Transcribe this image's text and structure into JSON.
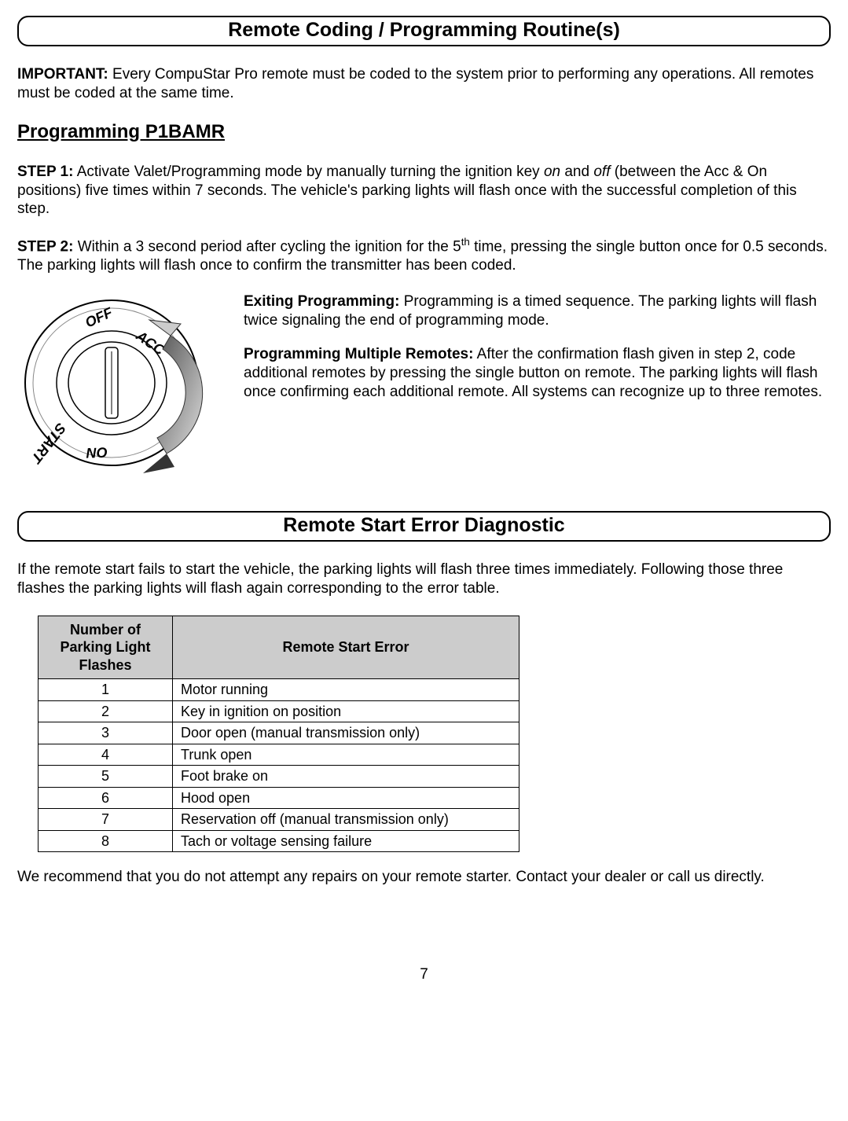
{
  "section1": {
    "title": "Remote Coding / Programming Routine(s)",
    "important_label": "IMPORTANT:",
    "important_text": " Every CompuStar Pro remote must be coded to the system prior to performing any operations. All remotes must be coded at the same time.",
    "subtitle": "Programming P1BAMR",
    "step1_label": "STEP 1:",
    "step1_a": " Activate Valet/Programming mode by manually turning the ignition key ",
    "step1_on": "on",
    "step1_b": " and ",
    "step1_off": "off",
    "step1_c": " (between the Acc & On positions) five times within 7 seconds. The vehicle's parking lights will flash once with the successful completion of this step.",
    "step2_label": "STEP 2:",
    "step2_a": " Within a 3 second period after cycling the ignition for the 5",
    "step2_th": "th",
    "step2_b": " time, pressing the single button once for 0.5 seconds. The parking lights will flash once to confirm the transmitter has been coded.",
    "exit_label": "Exiting Programming:",
    "exit_text": " Programming is a timed sequence. The parking lights will flash twice signaling the end of programming mode.",
    "multi_label": "Programming Multiple Remotes:",
    "multi_text": " After the confirmation flash given in step 2, code additional remotes by pressing the single button on remote. The parking lights will flash once confirming each additional remote. All systems can recognize up to three remotes.",
    "ignition_labels": {
      "off": "OFF",
      "acc": "ACC",
      "on": "ON",
      "start": "START"
    }
  },
  "section2": {
    "title": "Remote Start Error Diagnostic",
    "intro": "If the remote start fails to start the vehicle, the parking lights will flash three times immediately. Following those three flashes the parking lights will flash again corresponding to the error table.",
    "table": {
      "headers": {
        "col1": "Number of Parking Light Flashes",
        "col2": "Remote Start Error"
      },
      "rows": [
        {
          "n": "1",
          "e": "Motor running"
        },
        {
          "n": "2",
          "e": "Key in ignition on position"
        },
        {
          "n": "3",
          "e": "Door open (manual transmission only)"
        },
        {
          "n": "4",
          "e": "Trunk open"
        },
        {
          "n": "5",
          "e": "Foot brake on"
        },
        {
          "n": "6",
          "e": "Hood open"
        },
        {
          "n": "7",
          "e": "Reservation off (manual transmission only)"
        },
        {
          "n": "8",
          "e": "Tach or voltage sensing failure"
        }
      ]
    },
    "outro": "We recommend that you do not attempt any repairs on your remote starter. Contact your dealer or call us directly."
  },
  "page_number": "7"
}
